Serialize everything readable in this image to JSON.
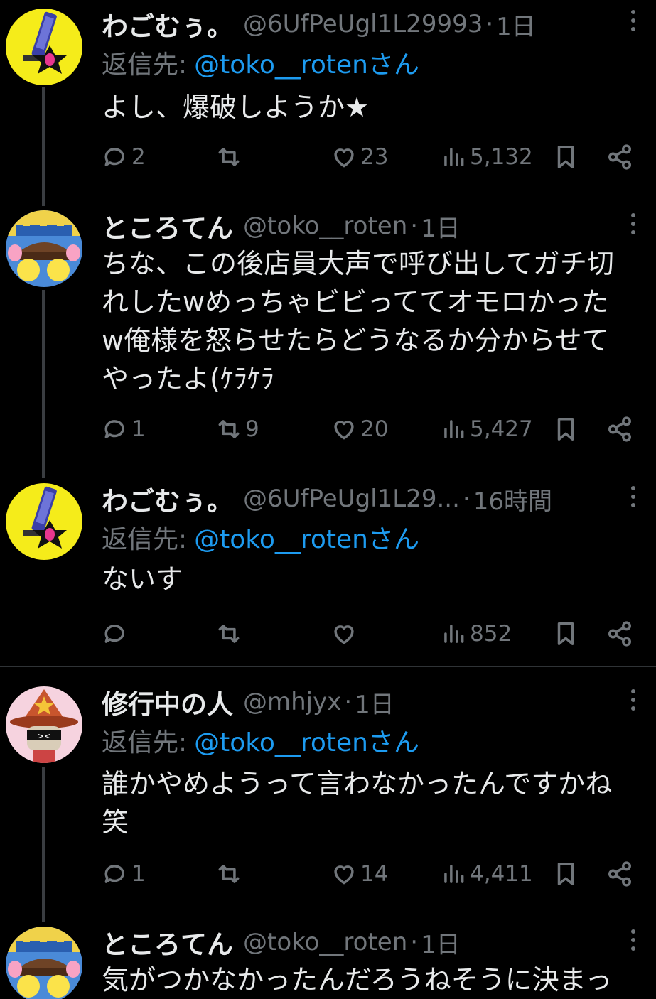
{
  "posts": [
    {
      "name": "わごむぅ。",
      "handle": "@6UfPeUgl1L29993",
      "time": "1日",
      "reply_prefix": "返信先:",
      "reply_to": "@toko__roten",
      "reply_suffix": "さん",
      "text": "よし、爆破しようか★",
      "replies": "2",
      "reposts": "",
      "likes": "23",
      "views": "5,132"
    },
    {
      "name": "ところてん",
      "handle": "@toko__roten",
      "time": "1日",
      "text": "ちな、この後店員大声で呼び出してガチ切\nれしたwめっちゃビビっててオモロかった\nw俺様を怒らせたらどうなるか分からせて\nやったよ(ｹﾗｹﾗ",
      "replies": "1",
      "reposts": "9",
      "likes": "20",
      "views": "5,427"
    },
    {
      "name": "わごむぅ。",
      "handle": "@6UfPeUgl1L29...",
      "time": "16時間",
      "reply_prefix": "返信先:",
      "reply_to": "@toko__roten",
      "reply_suffix": "さん",
      "text": "ないす",
      "replies": "",
      "reposts": "",
      "likes": "",
      "views": "852"
    },
    {
      "name": "修行中の人",
      "handle": "@mhjyx",
      "time": "1日",
      "reply_prefix": "返信先:",
      "reply_to": "@toko__roten",
      "reply_suffix": "さん",
      "text": "誰かやめようって言わなかったんですかね\n笑",
      "replies": "1",
      "reposts": "",
      "likes": "14",
      "views": "4,411"
    },
    {
      "name": "ところてん",
      "handle": "@toko__roten",
      "time": "1日",
      "text": "気がつかなかったんだろうねそうに決まっ"
    }
  ],
  "icons": {
    "reply": "speech-bubble-icon",
    "repost": "repost-arrows-icon",
    "like": "heart-icon",
    "views": "bar-chart-icon",
    "bookmark": "bookmark-icon",
    "share": "share-icon",
    "more": "vertical-ellipsis-icon"
  },
  "colors": {
    "background": "#000000",
    "text": "#e7e9ea",
    "muted": "#71767b",
    "link": "#1d9bf0",
    "thread_line": "#3a3d41"
  }
}
